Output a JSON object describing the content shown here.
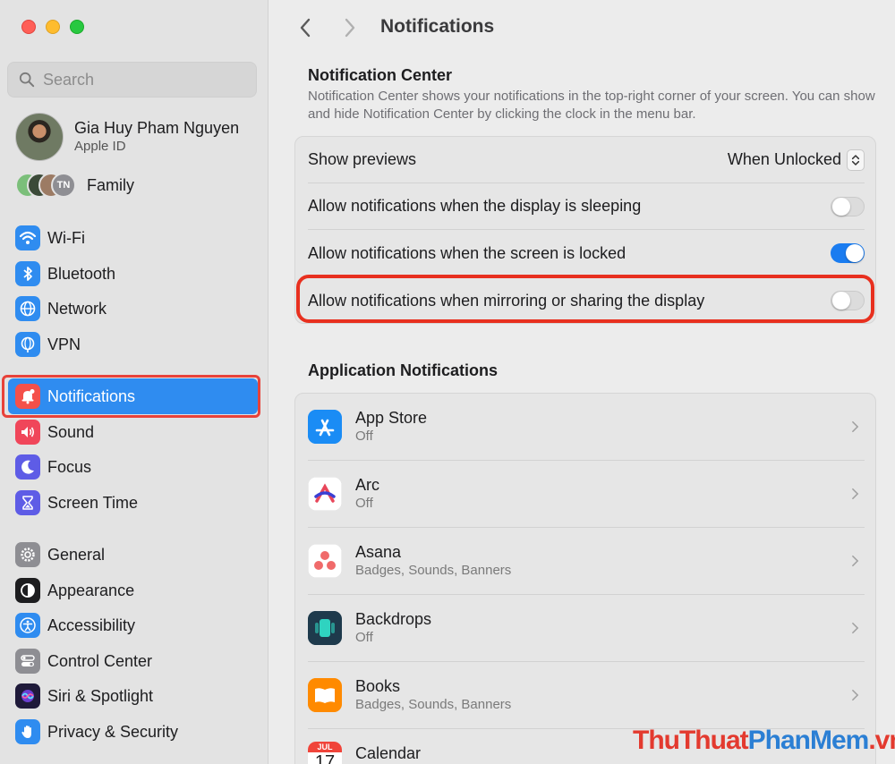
{
  "window": {
    "title": "Notifications"
  },
  "sidebar": {
    "search_placeholder": "Search",
    "profile": {
      "name": "Gia Huy Pham Nguyen",
      "subtitle": "Apple ID"
    },
    "family": {
      "label": "Family",
      "avatar_initials": "TN"
    },
    "groups": [
      [
        {
          "label": "Wi-Fi",
          "icon": "wifi-icon",
          "color": "#2f8cf0"
        },
        {
          "label": "Bluetooth",
          "icon": "bluetooth-icon",
          "color": "#2f8cf0"
        },
        {
          "label": "Network",
          "icon": "globe-icon",
          "color": "#2f8cf0"
        },
        {
          "label": "VPN",
          "icon": "vpn-globe-icon",
          "color": "#2f8cf0"
        }
      ],
      [
        {
          "label": "Notifications",
          "icon": "bell-icon",
          "color": "#f4504a",
          "active": true
        },
        {
          "label": "Sound",
          "icon": "speaker-icon",
          "color": "#f0465a"
        },
        {
          "label": "Focus",
          "icon": "moon-icon",
          "color": "#5e5ce6"
        },
        {
          "label": "Screen Time",
          "icon": "hourglass-icon",
          "color": "#5e5ce6"
        }
      ],
      [
        {
          "label": "General",
          "icon": "gear-icon",
          "color": "#8e8e93"
        },
        {
          "label": "Appearance",
          "icon": "appearance-icon",
          "color": "#1d1d1f"
        },
        {
          "label": "Accessibility",
          "icon": "accessibility-icon",
          "color": "#2f8cf0"
        },
        {
          "label": "Control Center",
          "icon": "control-center-icon",
          "color": "#8e8e93"
        },
        {
          "label": "Siri & Spotlight",
          "icon": "siri-icon",
          "color": "#3a2c6e"
        },
        {
          "label": "Privacy & Security",
          "icon": "hand-icon",
          "color": "#2f8cf0"
        }
      ]
    ]
  },
  "toolbar": {
    "title": "Notifications"
  },
  "notification_center": {
    "title": "Notification Center",
    "description": "Notification Center shows your notifications in the top-right corner of your screen. You can show and hide Notification Center by clicking the clock in the menu bar.",
    "show_previews": {
      "label": "Show previews",
      "value": "When Unlocked"
    },
    "toggles": [
      {
        "label": "Allow notifications when the display is sleeping",
        "state": "off"
      },
      {
        "label": "Allow notifications when the screen is locked",
        "state": "on"
      },
      {
        "label": "Allow notifications when mirroring or sharing the display",
        "state": "off"
      }
    ]
  },
  "app_notifications": {
    "title": "Application Notifications",
    "apps": [
      {
        "name": "App Store",
        "status": "Off",
        "icon": "app-store-icon"
      },
      {
        "name": "Arc",
        "status": "Off",
        "icon": "arc-icon"
      },
      {
        "name": "Asana",
        "status": "Badges, Sounds, Banners",
        "icon": "asana-icon"
      },
      {
        "name": "Backdrops",
        "status": "Off",
        "icon": "backdrops-icon"
      },
      {
        "name": "Books",
        "status": "Badges, Sounds, Banners",
        "icon": "books-icon"
      },
      {
        "name": "Calendar",
        "status": "",
        "icon": "calendar-icon",
        "calendar_month": "JUL",
        "calendar_day": "17"
      }
    ]
  },
  "watermark": {
    "part1": "ThuThuat",
    "part2": "PhanMem",
    "part3": ".vn"
  }
}
